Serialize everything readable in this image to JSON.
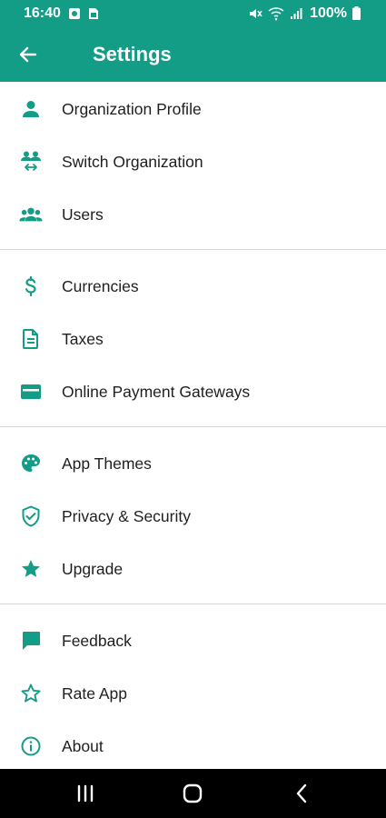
{
  "status_bar": {
    "time": "16:40",
    "battery": "100%",
    "icons": [
      "notification-icon",
      "sim-icon",
      "mute-icon",
      "wifi-icon",
      "signal-icon",
      "battery-icon"
    ]
  },
  "app_bar": {
    "title": "Settings",
    "back_icon": "arrow-back-icon"
  },
  "sections": [
    {
      "items": [
        {
          "label": "Organization Profile",
          "icon": "person-icon"
        },
        {
          "label": "Switch Organization",
          "icon": "switch-users-icon"
        },
        {
          "label": "Users",
          "icon": "group-icon"
        }
      ]
    },
    {
      "items": [
        {
          "label": "Currencies",
          "icon": "dollar-icon"
        },
        {
          "label": "Taxes",
          "icon": "document-icon"
        },
        {
          "label": "Online Payment Gateways",
          "icon": "credit-card-icon"
        }
      ]
    },
    {
      "items": [
        {
          "label": "App Themes",
          "icon": "palette-icon"
        },
        {
          "label": "Privacy & Security",
          "icon": "shield-icon"
        },
        {
          "label": "Upgrade",
          "icon": "star-icon"
        }
      ]
    },
    {
      "items": [
        {
          "label": "Feedback",
          "icon": "feedback-icon"
        },
        {
          "label": "Rate App",
          "icon": "star-outline-icon"
        },
        {
          "label": "About",
          "icon": "info-icon"
        }
      ]
    }
  ],
  "colors": {
    "primary": "#139c86",
    "text": "#1f1f1f",
    "divider": "#d6d6d6",
    "nav_bar": "#000000"
  }
}
